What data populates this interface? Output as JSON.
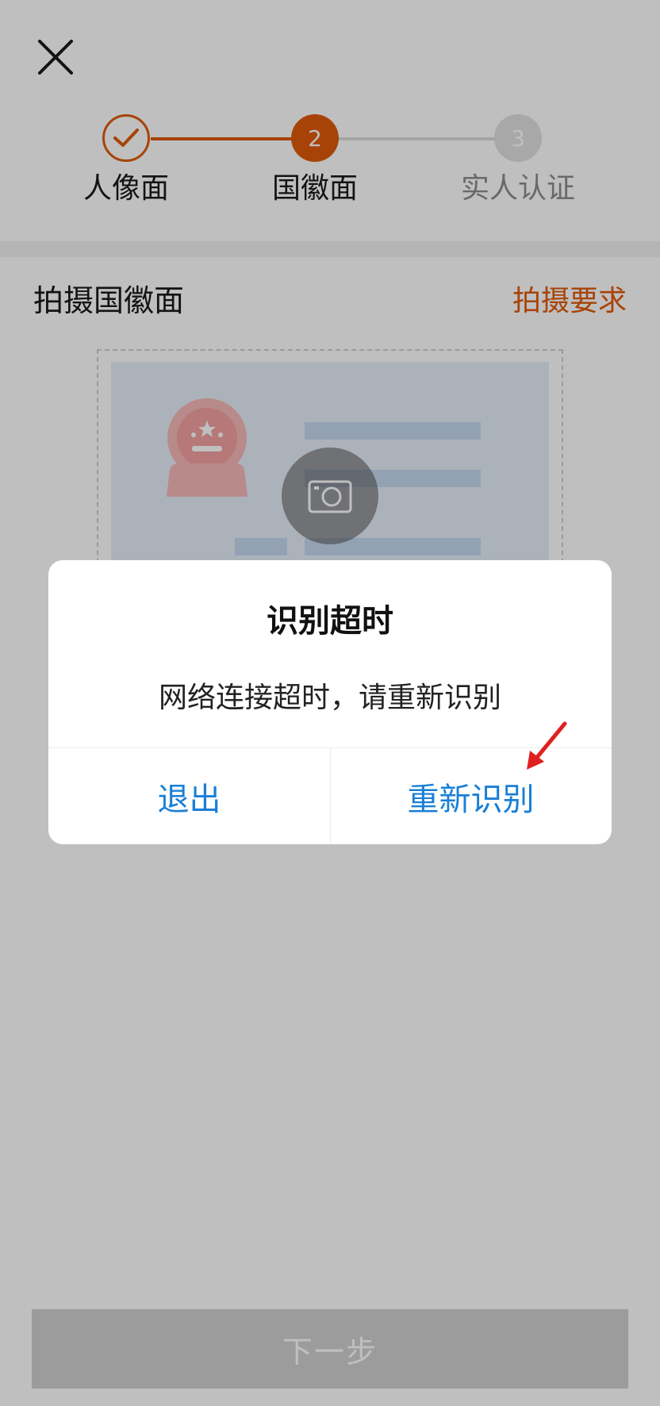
{
  "header": {
    "close_icon": "close-icon"
  },
  "steps": [
    {
      "label": "人像面",
      "state": "done"
    },
    {
      "label": "国徽面",
      "number": "2",
      "state": "active"
    },
    {
      "label": "实人认证",
      "number": "3",
      "state": "pending"
    }
  ],
  "section": {
    "title": "拍摄国徽面",
    "requirements_link": "拍摄要求"
  },
  "card": {
    "camera_icon": "camera-icon"
  },
  "footer": {
    "next_label": "下一步"
  },
  "dialog": {
    "title": "识别超时",
    "message": "网络连接超时，请重新识别",
    "exit_label": "退出",
    "retry_label": "重新识别"
  },
  "colors": {
    "accent": "#e05a0a",
    "link_blue": "#1a7fd6",
    "annotation_red": "#e02020"
  }
}
